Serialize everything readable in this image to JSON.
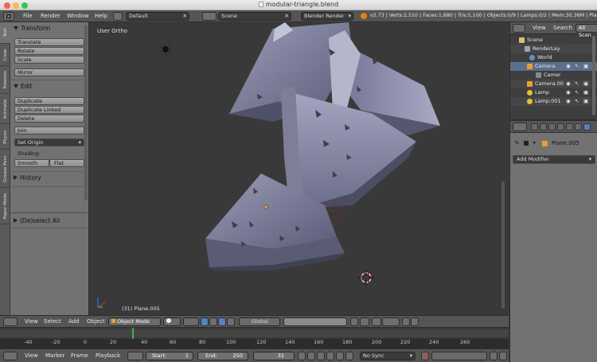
{
  "window": {
    "title": "modular-triangle.blend"
  },
  "info_header": {
    "menus": [
      "File",
      "Render",
      "Window",
      "Help"
    ],
    "screen_layout": "Default",
    "scene": "Scene",
    "engine": "Blender Render",
    "stats": "v2.73 | Verts:2,510 | Faces:1,680 | Tris:5,100 | Objects:0/9 | Lamps:0/2 | Mem:30.36M | Plane.0"
  },
  "toolshelf": {
    "tabs": [
      "Tool",
      "Creat",
      "Relation",
      "Animatio",
      "Physic",
      "Grease Penc",
      "Paper Mode"
    ],
    "transform": {
      "header": "Transform",
      "buttons": [
        "Translate",
        "Rotate",
        "Scale",
        "Mirror"
      ]
    },
    "edit": {
      "header": "Edit",
      "buttons": [
        "Duplicate",
        "Duplicate Linked",
        "Delete",
        "Join"
      ],
      "set_origin": "Set Origin",
      "shading_label": "Shading:",
      "smooth": "Smooth",
      "flat": "Flat"
    },
    "history": {
      "header": "History"
    },
    "operator": {
      "header": "(De)select All"
    }
  },
  "viewport": {
    "view_label": "User Ortho",
    "object_label": "(31) Plane.005"
  },
  "viewport_header": {
    "menus": [
      "View",
      "Select",
      "Add",
      "Object"
    ],
    "mode": "Object Mode",
    "orientation": "Global"
  },
  "timeline": {
    "ticks": [
      "-40",
      "-20",
      "0",
      "20",
      "40",
      "60",
      "80",
      "100",
      "120",
      "140",
      "160",
      "180",
      "200",
      "220",
      "240",
      "260"
    ],
    "menus": [
      "View",
      "Marker",
      "Frame",
      "Playback"
    ],
    "start_label": "Start:",
    "start_value": "1",
    "end_label": "End:",
    "end_value": "250",
    "current_frame": "31",
    "sync": "No Sync",
    "current_frame_number": 31
  },
  "outliner": {
    "tabs": [
      "View",
      "Search",
      "All Scen"
    ],
    "items": [
      {
        "label": "Scene",
        "icon": "scene-icon"
      },
      {
        "label": "RenderLay",
        "icon": "render-layer-icon"
      },
      {
        "label": "World",
        "icon": "world-icon"
      },
      {
        "label": "Camera",
        "icon": "camera-object-icon"
      },
      {
        "label": "Camer",
        "icon": "camera-data-icon"
      },
      {
        "label": "Camera.00",
        "icon": "camera-object-icon"
      },
      {
        "label": "Lamp",
        "icon": "lamp-icon"
      },
      {
        "label": "Lamp.001",
        "icon": "lamp-icon"
      }
    ]
  },
  "properties": {
    "object_name": "Plane.005",
    "add_modifier": "Add Modifier"
  },
  "colors": {
    "accent": "#5680c2",
    "selected_row": "#5c6e8e",
    "current_frame": "#40b040",
    "record": "#d04040"
  }
}
